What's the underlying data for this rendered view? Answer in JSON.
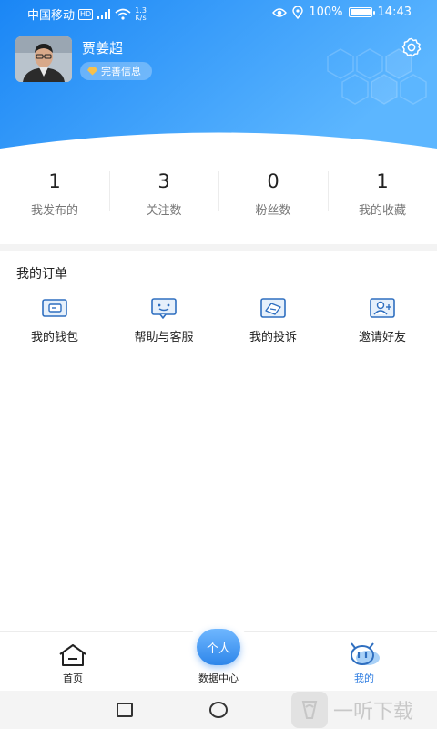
{
  "status_bar": {
    "carrier": "中国移动",
    "hd": "HD",
    "net_speed_value": "1.3",
    "net_speed_unit": "K/s",
    "battery": "100%",
    "time": "14:43"
  },
  "profile": {
    "name": "贾姜超",
    "complete_info": "完善信息"
  },
  "stats": [
    {
      "value": "1",
      "label": "我发布的"
    },
    {
      "value": "3",
      "label": "关注数"
    },
    {
      "value": "0",
      "label": "粉丝数"
    },
    {
      "value": "1",
      "label": "我的收藏"
    }
  ],
  "orders": {
    "title": "我的订单",
    "actions": [
      {
        "label": "我的钱包",
        "icon": "wallet-icon"
      },
      {
        "label": "帮助与客服",
        "icon": "customer-service-icon"
      },
      {
        "label": "我的投诉",
        "icon": "complaint-icon"
      },
      {
        "label": "邀请好友",
        "icon": "invite-friend-icon"
      }
    ]
  },
  "bottom_nav": {
    "home": "首页",
    "center_button": "个人",
    "data_center": "数据中心",
    "mine": "我的"
  },
  "watermark": {
    "text": "一听下载"
  },
  "colors": {
    "primary": "#2f7de1",
    "header_gradient_start": "#1a86f5",
    "header_gradient_end": "#5cb6ff",
    "icon_stroke": "#2f6fc0"
  }
}
